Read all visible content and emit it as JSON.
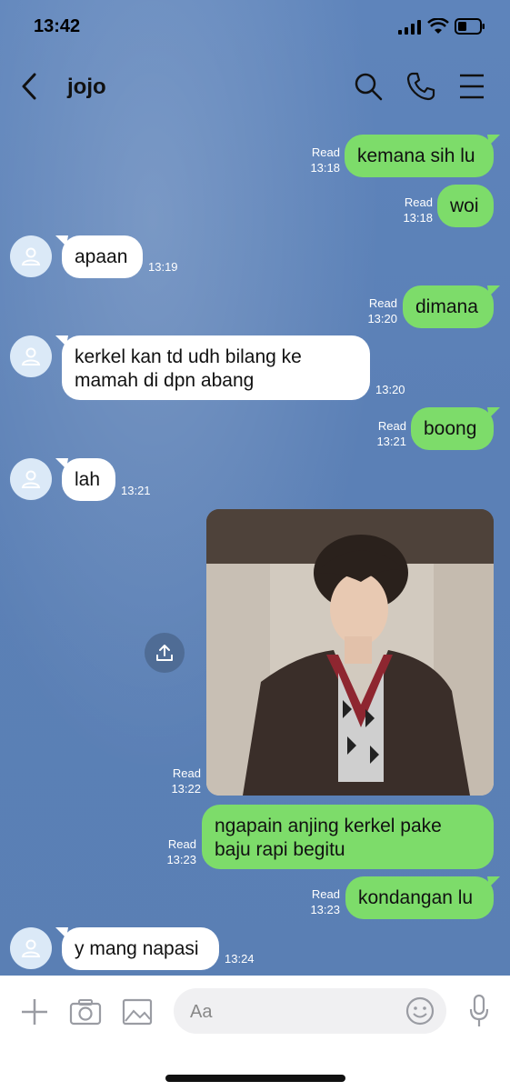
{
  "status_bar": {
    "time": "13:42"
  },
  "header": {
    "contact_name": "jojo"
  },
  "messages": [
    {
      "text": "kemana sih lu",
      "read": "Read",
      "time": "13:18"
    },
    {
      "text": "woi",
      "read": "Read",
      "time": "13:18"
    },
    {
      "text": "apaan",
      "time": "13:19"
    },
    {
      "text": "dimana",
      "read": "Read",
      "time": "13:20"
    },
    {
      "text_line1": "kerkel kan td udh bilang ke",
      "text_line2": "mamah di dpn abang",
      "time": "13:20"
    },
    {
      "text": "boong",
      "read": "Read",
      "time": "13:21"
    },
    {
      "text": "lah",
      "time": "13:21"
    },
    {
      "type": "photo",
      "read": "Read",
      "time": "13:22"
    },
    {
      "text_line1": "ngapain anjing kerkel pake",
      "text_line2": "baju rapi begitu",
      "read": "Read",
      "time": "13:23"
    },
    {
      "text": "kondangan lu",
      "read": "Read",
      "time": "13:23"
    },
    {
      "text": "y mang napasi",
      "time": "13:24"
    }
  ],
  "composer": {
    "placeholder": "Aa"
  },
  "icons": {
    "back": "chevron-left-icon",
    "search": "search-icon",
    "call": "phone-icon",
    "menu": "menu-icon",
    "plus": "plus-icon",
    "camera": "camera-icon",
    "image": "image-icon",
    "emoji": "emoji-icon",
    "mic": "microphone-icon",
    "share": "share-icon",
    "avatar": "user-icon"
  },
  "colors": {
    "background": "#5e84bb",
    "outgoing_bubble": "#7ddc6a",
    "incoming_bubble": "#ffffff"
  }
}
